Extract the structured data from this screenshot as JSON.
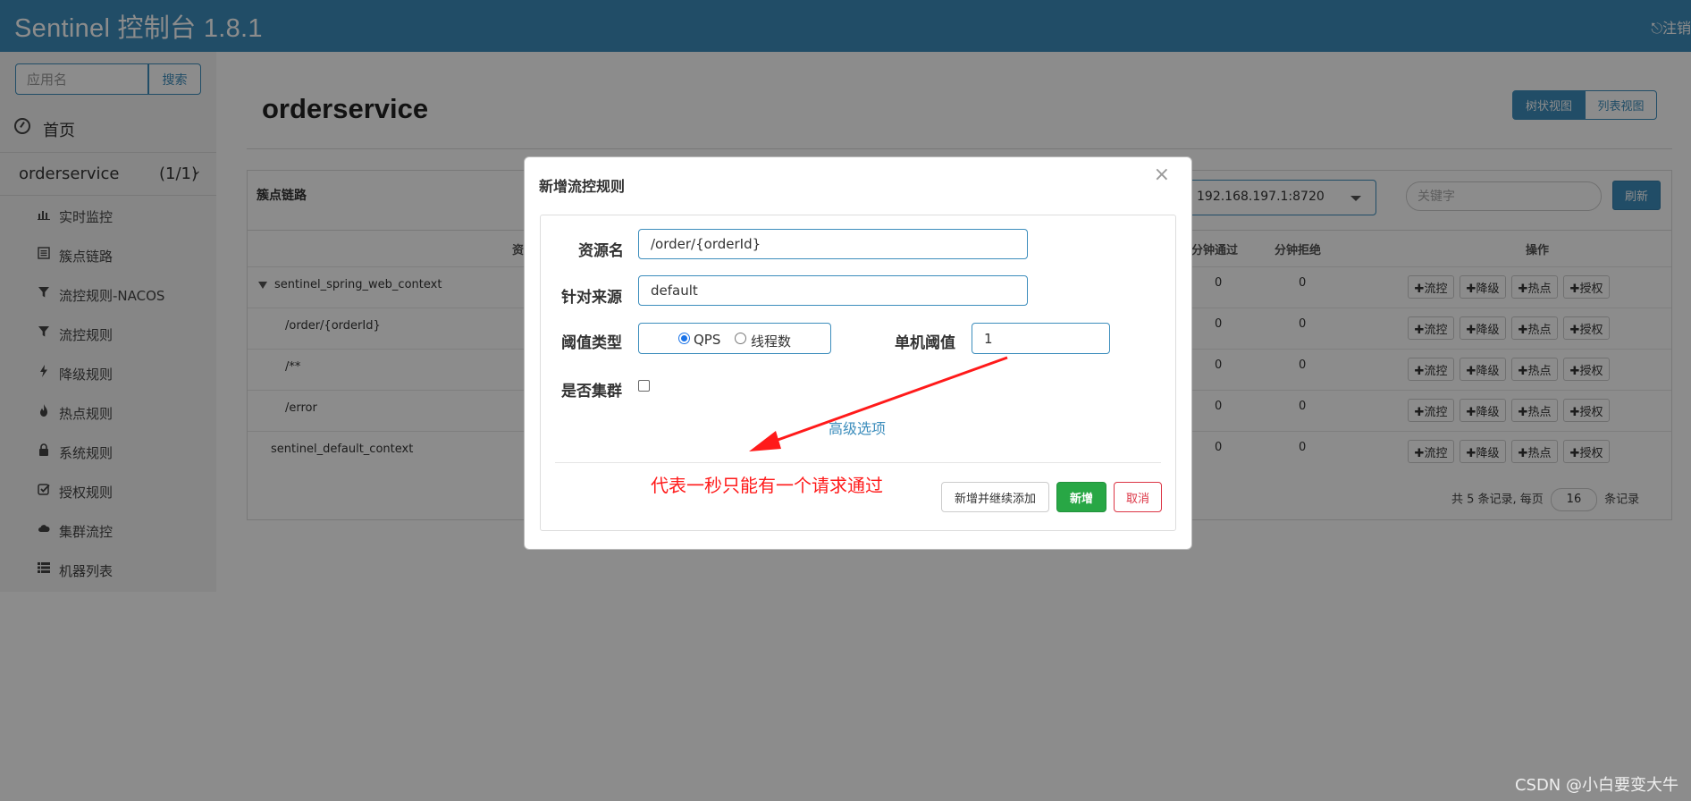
{
  "header": {
    "title": "Sentinel 控制台 1.8.1",
    "logout": "⎋注销"
  },
  "sidebar": {
    "search": {
      "placeholder": "应用名",
      "button": "搜索"
    },
    "home": "首页",
    "app": {
      "name": "orderservice",
      "count": "(1/1)"
    },
    "items": [
      {
        "label": "实时监控",
        "icon": "bar-chart-icon"
      },
      {
        "label": "簇点链路",
        "icon": "list-icon"
      },
      {
        "label": "流控规则-NACOS",
        "icon": "filter-icon"
      },
      {
        "label": "流控规则",
        "icon": "filter-icon"
      },
      {
        "label": "降级规则",
        "icon": "flash-icon"
      },
      {
        "label": "热点规则",
        "icon": "fire-icon"
      },
      {
        "label": "系统规则",
        "icon": "lock-icon"
      },
      {
        "label": "授权规则",
        "icon": "check-square-icon"
      },
      {
        "label": "集群流控",
        "icon": "cloud-icon"
      },
      {
        "label": "机器列表",
        "icon": "th-list-icon"
      }
    ]
  },
  "main": {
    "title": "orderservice",
    "view_tree": "树状视图",
    "view_list": "列表视图",
    "panel_title": "簇点链路",
    "machine": "192.168.197.1:8720",
    "keyword_placeholder": "关键字",
    "refresh": "刷新",
    "headers": {
      "resource": "资源名",
      "pass": "分钟通过",
      "reject": "分钟拒绝",
      "ops": "操作"
    },
    "rows": [
      {
        "name": "sentinel_spring_web_context",
        "pass": "0",
        "reject": "0"
      },
      {
        "name": "/order/{orderId}",
        "pass": "0",
        "reject": "0"
      },
      {
        "name": "/**",
        "pass": "0",
        "reject": "0"
      },
      {
        "name": "/error",
        "pass": "0",
        "reject": "0"
      },
      {
        "name": "sentinel_default_context",
        "pass": "0",
        "reject": "0"
      }
    ],
    "ops": {
      "flow": "✚流控",
      "degrade": "✚降级",
      "hot": "✚热点",
      "auth": "✚授权"
    },
    "pager": {
      "prefix": "共 5 条记录, 每页",
      "size": "16",
      "suffix": "条记录"
    }
  },
  "modal": {
    "title": "新增流控规则",
    "close": "×",
    "resource_label": "资源名",
    "resource_value": "/order/{orderId}",
    "origin_label": "针对来源",
    "origin_value": "default",
    "grade_label": "阈值类型",
    "grade_qps": "QPS",
    "grade_thread": "线程数",
    "threshold_label": "单机阈值",
    "threshold_value": "1",
    "cluster_label": "是否集群",
    "advanced": "高级选项",
    "annotation": "代表一秒只能有一个请求通过",
    "btn_continue": "新增并继续添加",
    "btn_add": "新增",
    "btn_cancel": "取消"
  },
  "watermark": "CSDN @小白要变大牛",
  "colors": {
    "brand": "#3c8dbc",
    "annotation": "#ff1a1a",
    "add": "#28a745",
    "cancel": "#dc3545"
  }
}
